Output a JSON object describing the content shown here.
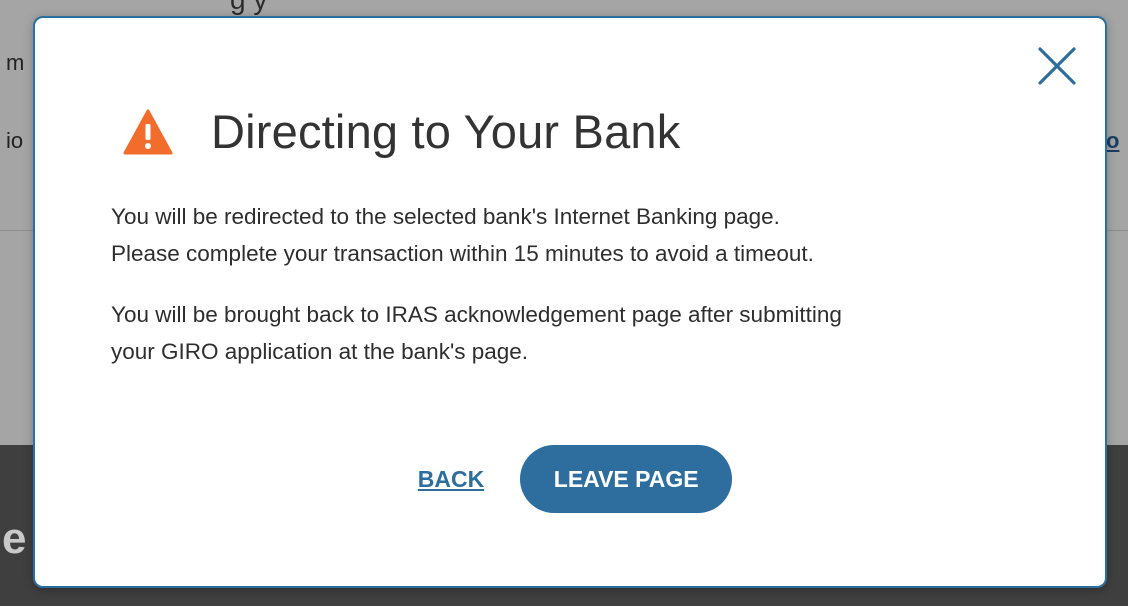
{
  "background": {
    "top_fragment": "g     y",
    "text_line_1": "m",
    "text_line_2": "io",
    "right_link_fragment": "o",
    "dark_band_fragment": "e A"
  },
  "dialog": {
    "title": "Directing to Your Bank",
    "paragraph_1": [
      "You will be redirected to the selected bank's Internet Banking page.",
      "Please complete your transaction within 15 minutes to avoid a timeout."
    ],
    "paragraph_2": [
      "You will be brought back to IRAS acknowledgement page after submitting",
      "your GIRO application at the bank's page."
    ],
    "back_label": "BACK",
    "leave_label": "LEAVE PAGE",
    "close_icon": "close-icon",
    "warning_icon": "warning-icon"
  },
  "colors": {
    "accent": "#2e6e9e",
    "warning": "#f26d2b",
    "border": "#2a6fa0"
  }
}
